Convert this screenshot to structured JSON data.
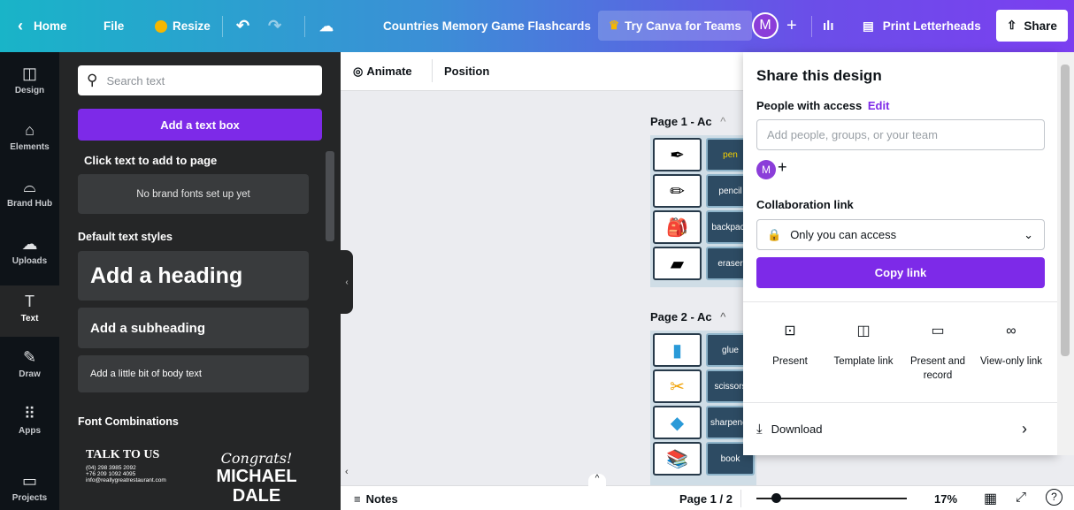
{
  "topbar": {
    "home": "Home",
    "file": "File",
    "resize": "Resize",
    "title": "Countries Memory Game Flashcards",
    "try_teams": "Try Canva for Teams",
    "avatar": "M",
    "print": "Print Letterheads",
    "share": "Share"
  },
  "rail": [
    {
      "label": "Design",
      "icon": "layout-icon"
    },
    {
      "label": "Elements",
      "icon": "shapes-icon"
    },
    {
      "label": "Brand Hub",
      "icon": "brand-icon"
    },
    {
      "label": "Uploads",
      "icon": "upload-icon"
    },
    {
      "label": "Text",
      "icon": "text-icon"
    },
    {
      "label": "Draw",
      "icon": "draw-icon"
    },
    {
      "label": "Apps",
      "icon": "apps-icon"
    },
    {
      "label": "Projects",
      "icon": "folder-icon"
    }
  ],
  "panel": {
    "search_placeholder": "Search text",
    "add_text_box": "Add a text box",
    "click_text": "Click text to add to page",
    "no_brand": "No brand fonts set up yet",
    "default_styles": "Default text styles",
    "heading": "Add a heading",
    "subheading": "Add a subheading",
    "body": "Add a little bit of body text",
    "font_combos": "Font Combinations",
    "combo1_title": "TALK TO US",
    "combo1_line1": "(04) 298 3985 2092",
    "combo1_line2": "+76 209 1092 4095",
    "combo1_line3": "info@reallygreatrestaurant.com",
    "combo2_script": "Congrats!",
    "combo2_name1": "MICHAEL",
    "combo2_name2": "DALE"
  },
  "toolbar": {
    "animate": "Animate",
    "position": "Position"
  },
  "canvas": {
    "page1_label": "Page 1 - Ac",
    "page2_label": "Page 2 - Ac",
    "page1_words": [
      "pen",
      "pencil",
      "backpack",
      "eraser"
    ],
    "page2_words": [
      "glue",
      "scissors",
      "sharpener",
      "book"
    ]
  },
  "bottom": {
    "notes": "Notes",
    "page": "Page 1 / 2",
    "zoom": "17%",
    "zoom_level": 0.17
  },
  "share": {
    "title": "Share this design",
    "people": "People with access",
    "edit": "Edit",
    "placeholder": "Add people, groups, or your team",
    "avatar": "M",
    "collab": "Collaboration link",
    "access": "Only you can access",
    "copy": "Copy link",
    "options": [
      {
        "label": "Present",
        "icon": "present-icon"
      },
      {
        "label": "Template link",
        "icon": "template-icon"
      },
      {
        "label": "Present and record",
        "icon": "record-icon"
      },
      {
        "label": "View-only link",
        "icon": "link-icon"
      }
    ],
    "download": "Download"
  },
  "colors": {
    "accent": "#7d2ae8",
    "dark": "#252627"
  }
}
